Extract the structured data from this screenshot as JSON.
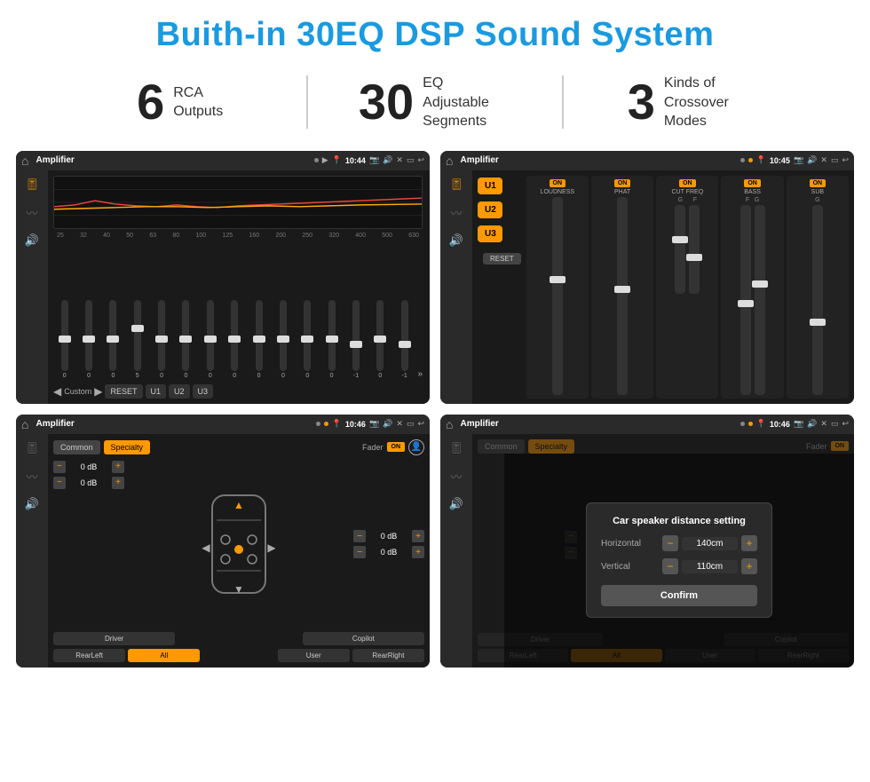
{
  "page": {
    "title": "Buith-in 30EQ DSP Sound System"
  },
  "stats": [
    {
      "number": "6",
      "label": "RCA\nOutputs"
    },
    {
      "number": "30",
      "label": "EQ Adjustable\nSegments"
    },
    {
      "number": "3",
      "label": "Kinds of\nCrossover Modes"
    }
  ],
  "screens": [
    {
      "id": "eq-screen",
      "title": "Amplifier",
      "time": "10:44",
      "type": "equalizer"
    },
    {
      "id": "crossover-screen",
      "title": "Amplifier",
      "time": "10:45",
      "type": "crossover"
    },
    {
      "id": "fader-screen",
      "title": "Amplifier",
      "time": "10:46",
      "type": "fader"
    },
    {
      "id": "dialog-screen",
      "title": "Amplifier",
      "time": "10:46",
      "type": "dialog"
    }
  ],
  "eq": {
    "frequencies": [
      "25",
      "32",
      "40",
      "50",
      "63",
      "80",
      "100",
      "125",
      "160",
      "200",
      "250",
      "320",
      "400",
      "500",
      "630"
    ],
    "values": [
      "0",
      "0",
      "0",
      "5",
      "0",
      "0",
      "0",
      "0",
      "0",
      "0",
      "0",
      "0",
      "-1",
      "0",
      "-1"
    ],
    "buttons": [
      "Custom",
      "RESET",
      "U1",
      "U2",
      "U3"
    ]
  },
  "crossover": {
    "u_buttons": [
      "U1",
      "U2",
      "U3"
    ],
    "panels": [
      {
        "toggle": "ON",
        "label": "LOUDNESS"
      },
      {
        "toggle": "ON",
        "label": "PHAT"
      },
      {
        "toggle": "ON",
        "label": "CUT FREQ"
      },
      {
        "toggle": "ON",
        "label": "BASS"
      },
      {
        "toggle": "ON",
        "label": "SUB"
      }
    ],
    "reset": "RESET"
  },
  "fader": {
    "tabs": [
      "Common",
      "Specialty"
    ],
    "fader_label": "Fader",
    "toggle": "ON",
    "controls": [
      {
        "label": "0 dB"
      },
      {
        "label": "0 dB"
      },
      {
        "label": "0 dB"
      },
      {
        "label": "0 dB"
      }
    ],
    "bottom_btns": [
      "Driver",
      "",
      "Copilot",
      "RearLeft",
      "All",
      "",
      "User",
      "RearRight"
    ]
  },
  "dialog": {
    "title": "Car speaker distance setting",
    "horizontal_label": "Horizontal",
    "horizontal_value": "140cm",
    "vertical_label": "Vertical",
    "vertical_value": "110cm",
    "confirm_label": "Confirm"
  }
}
